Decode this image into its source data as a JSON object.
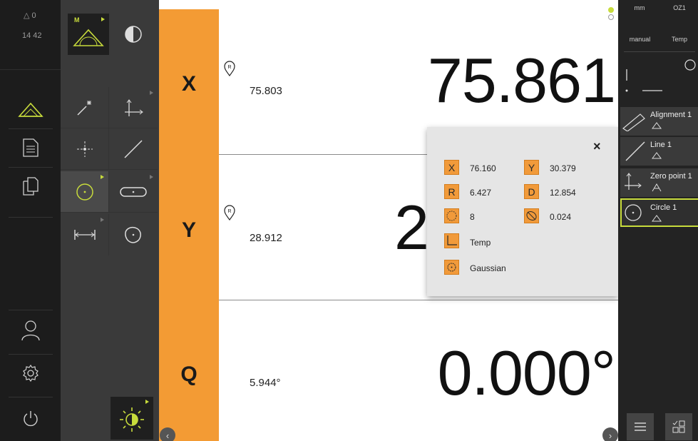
{
  "status": {
    "warnings": "0",
    "time": "14 42"
  },
  "axes": [
    {
      "label": "X",
      "nominal": "75.803",
      "actual": "75.861"
    },
    {
      "label": "Y",
      "nominal": "28.912",
      "actual": "2"
    },
    {
      "label": "Q",
      "nominal": "5.944°",
      "actual": "0.000°"
    }
  ],
  "popup": {
    "close": "×",
    "x_label": "X",
    "x_value": "76.160",
    "y_label": "Y",
    "y_value": "30.379",
    "r_label": "R",
    "r_value": "6.427",
    "d_label": "D",
    "d_value": "12.854",
    "points_value": "8",
    "form_value": "0.024",
    "coord_system": "Temp",
    "fit_method": "Gaussian"
  },
  "right_panel": {
    "unit": "mm",
    "coord_label": "OZ1",
    "mode": "manual",
    "coord_system": "Temp",
    "features": [
      {
        "label": "Alignment 1"
      },
      {
        "label": "Line 1"
      },
      {
        "label": "Zero point 1"
      },
      {
        "label": "Circle 1"
      }
    ]
  },
  "tools": {
    "mode_badge": "M"
  },
  "colors": {
    "accent": "#f39b34",
    "highlight": "#c8dc3c"
  }
}
